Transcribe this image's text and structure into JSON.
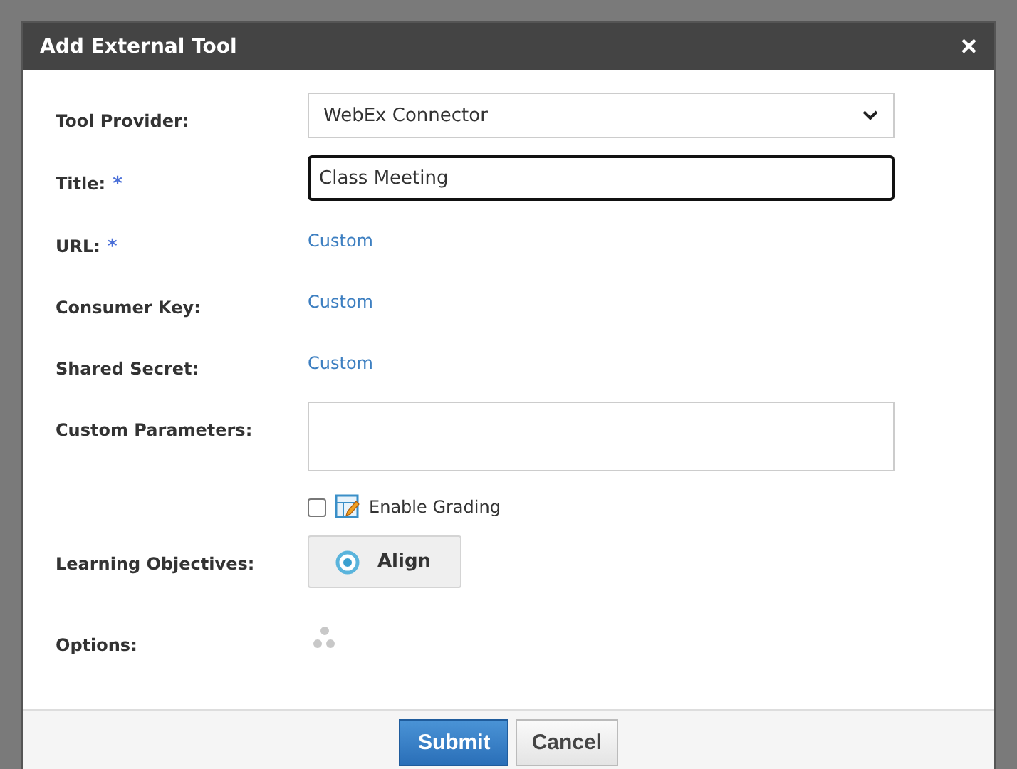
{
  "dialog": {
    "title": "Add External Tool",
    "close": "×"
  },
  "fields": [
    {
      "kind": "select",
      "label": "Tool Provider:",
      "required": false,
      "value": "WebEx Connector"
    },
    {
      "kind": "input",
      "label": "Title:",
      "required": true,
      "value": "Class Meeting",
      "focused": true
    },
    {
      "kind": "link",
      "label": "URL:",
      "required": true,
      "value": "Custom"
    },
    {
      "kind": "link",
      "label": "Consumer Key:",
      "required": false,
      "value": "Custom"
    },
    {
      "kind": "link",
      "label": "Shared Secret:",
      "required": false,
      "value": "Custom"
    },
    {
      "kind": "textarea",
      "label": "Custom Parameters:",
      "required": false
    },
    {
      "kind": "checkbox",
      "text": "Enable Grading",
      "checked": false
    },
    {
      "kind": "button",
      "label": "Learning Objectives:",
      "required": false,
      "value": "Align"
    },
    {
      "kind": "spinner",
      "label": "Options:",
      "required": false
    }
  ],
  "required_mark": "*",
  "buttons": [
    {
      "label": "Submit",
      "primary": true
    },
    {
      "label": "Cancel",
      "primary": false
    }
  ]
}
